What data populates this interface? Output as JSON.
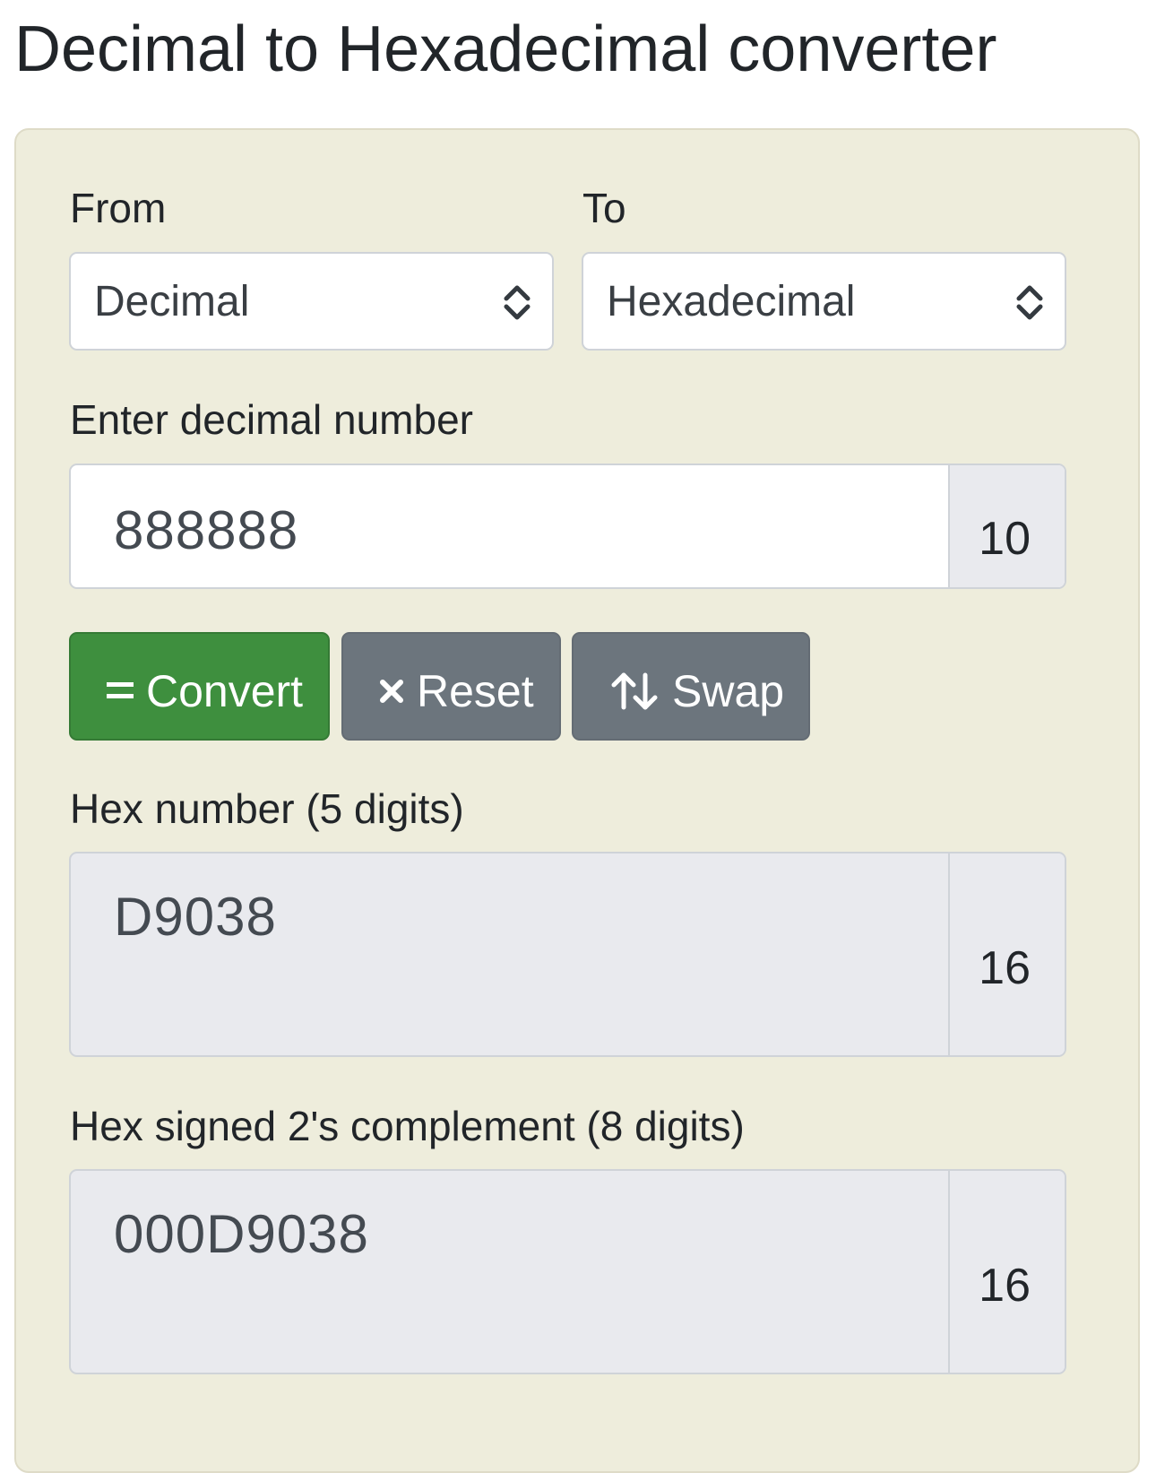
{
  "page": {
    "title": "Decimal to Hexadecimal converter"
  },
  "converter": {
    "from_label": "From",
    "to_label": "To",
    "from_select": {
      "value": "Decimal"
    },
    "to_select": {
      "value": "Hexadecimal"
    },
    "input_label": "Enter decimal number",
    "input_value": "888888",
    "input_base": "10",
    "buttons": {
      "convert": {
        "icon": "equals-icon",
        "label": "Convert",
        "color": "#3e8f3e"
      },
      "reset": {
        "icon": "close-icon",
        "label": "Reset",
        "color": "#6c757d"
      },
      "swap": {
        "icon": "swap-arrows-icon",
        "label": "Swap",
        "color": "#6c757d"
      }
    },
    "hex_label": "Hex number (5 digits)",
    "hex_value": "D9038",
    "hex_base": "16",
    "twos_label": "Hex signed 2's complement (8 digits)",
    "twos_value": "000D9038",
    "twos_base": "16"
  },
  "colors": {
    "card_background": "#eeeddc",
    "readonly_background": "#e9eaee",
    "text": "#212529"
  }
}
